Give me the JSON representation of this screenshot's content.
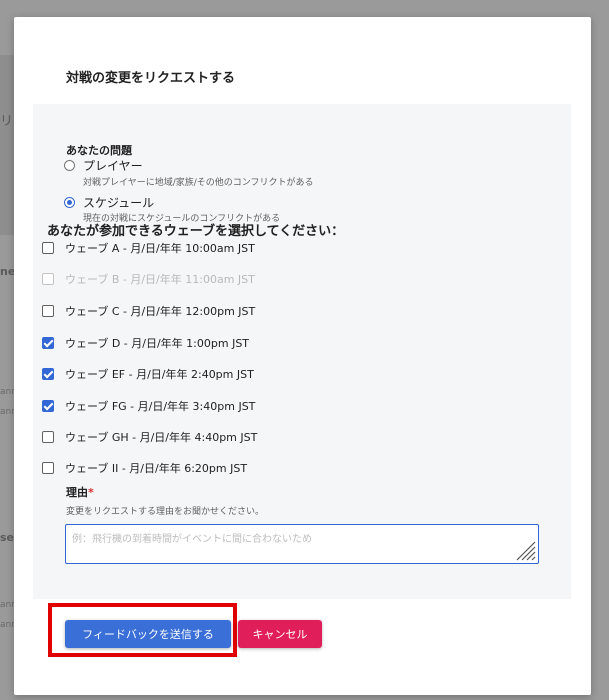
{
  "background": {
    "fragments": [
      "リ",
      "ne",
      "ann",
      "ann",
      "ser",
      "ann",
      "ann"
    ]
  },
  "modal": {
    "title": "対戦の変更をリクエストする",
    "issue": {
      "label": "あなたの問題",
      "options": [
        {
          "label": "プレイヤー",
          "help": "対戦プレイヤーに地域/家族/その他のコンフリクトがある",
          "selected": false
        },
        {
          "label": "スケジュール",
          "help": "現在の対戦にスケジュールのコンフリクトがある",
          "selected": true
        }
      ]
    },
    "waves": {
      "heading": "あなたが参加できるウェーブを選択してください：",
      "items": [
        {
          "label": "ウェーブ A - 月/日/年年 10:00am JST",
          "checked": false,
          "disabled": false
        },
        {
          "label": "ウェーブ B - 月/日/年年 11:00am JST",
          "checked": false,
          "disabled": true
        },
        {
          "label": "ウェーブ C - 月/日/年年 12:00pm JST",
          "checked": false,
          "disabled": false
        },
        {
          "label": "ウェーブ D - 月/日/年年 1:00pm JST",
          "checked": true,
          "disabled": false
        },
        {
          "label": "ウェーブ EF - 月/日/年年 2:40pm JST",
          "checked": true,
          "disabled": false
        },
        {
          "label": "ウェーブ FG - 月/日/年年 3:40pm JST",
          "checked": true,
          "disabled": false
        },
        {
          "label": "ウェーブ GH - 月/日/年年 4:40pm JST",
          "checked": false,
          "disabled": false
        },
        {
          "label": "ウェーブ II - 月/日/年年 6:20pm JST",
          "checked": false,
          "disabled": false
        }
      ]
    },
    "reason": {
      "label": "理由",
      "required_mark": "*",
      "help": "変更をリクエストする理由をお聞かせください。",
      "value": "",
      "placeholder": "例：飛行機の到着時間がイベントに間に合わないため"
    },
    "buttons": {
      "submit": "フィードバックを送信する",
      "cancel": "キャンセル"
    }
  },
  "colors": {
    "accent": "#3367d6",
    "primary_button": "#3a6fd8",
    "cancel_button": "#e01e5a",
    "highlight": "#e00000",
    "overlay": "#8a8a8a"
  }
}
